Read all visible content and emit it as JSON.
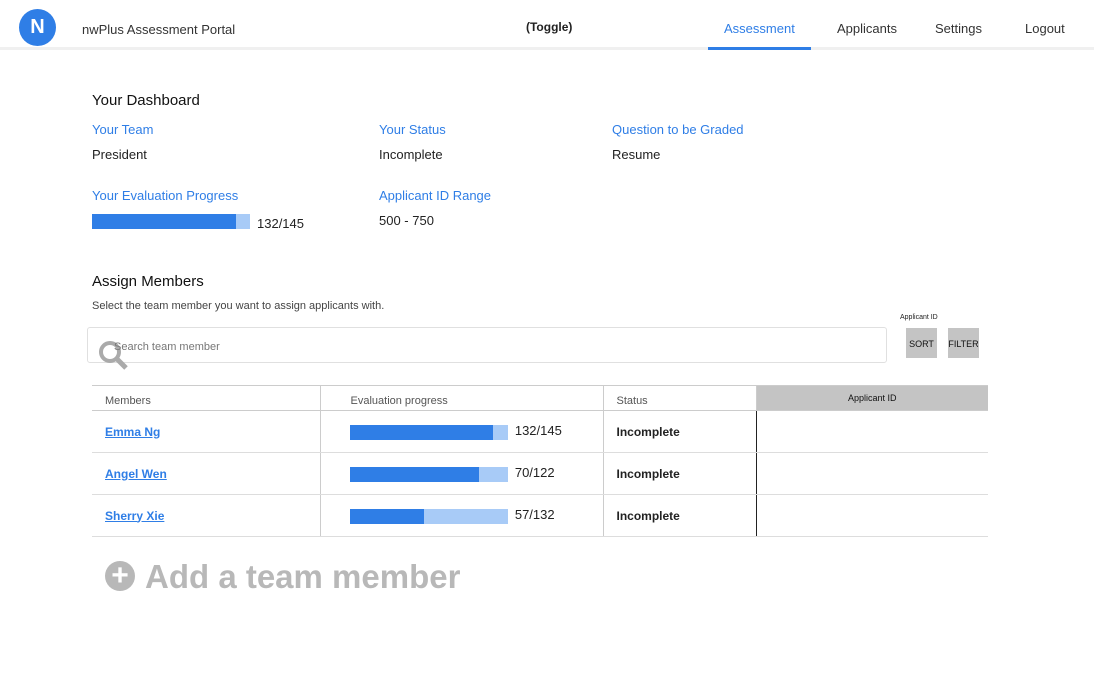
{
  "header": {
    "logo_text": "N",
    "title": "nwPlus Assessment Portal",
    "toggle": "(Toggle)",
    "nav": [
      "Assessment",
      "Applicants",
      "Settings",
      "Logout"
    ]
  },
  "dashboard": {
    "title": "Your Dashboard",
    "team_label": "Your Team",
    "team": "President",
    "status_label": "Your Status",
    "status": "Incomplete",
    "question_label": "Question to be Graded",
    "question": "Resume",
    "progress_label": "Your Evaluation Progress",
    "progress_text": "132/145",
    "progress_fraction": 0.91,
    "range_label": "Applicant ID Range",
    "range": "500 - 750"
  },
  "assign": {
    "title": "Assign Members",
    "subtitle": "Select the team member you want to assign applicants with.",
    "search_placeholder": "Search team member",
    "applicant_id_label": "Applicant ID",
    "sort": "SORT",
    "filter": "FILTER",
    "columns": [
      "Members",
      "Evaluation progress",
      "Status",
      "Applicant ID"
    ],
    "rows": [
      {
        "name": "Emma Ng",
        "progress": "132/145",
        "fraction": 0.91,
        "status": "Incomplete"
      },
      {
        "name": "Angel Wen",
        "progress": "70/122",
        "fraction": 0.82,
        "status": "Incomplete"
      },
      {
        "name": "Sherry Xie",
        "progress": "57/132",
        "fraction": 0.47,
        "status": "Incomplete"
      }
    ],
    "add_label": "Add a team member"
  },
  "colors": {
    "accent": "#2f7ee6",
    "bar_bg": "#a8cbf7"
  }
}
